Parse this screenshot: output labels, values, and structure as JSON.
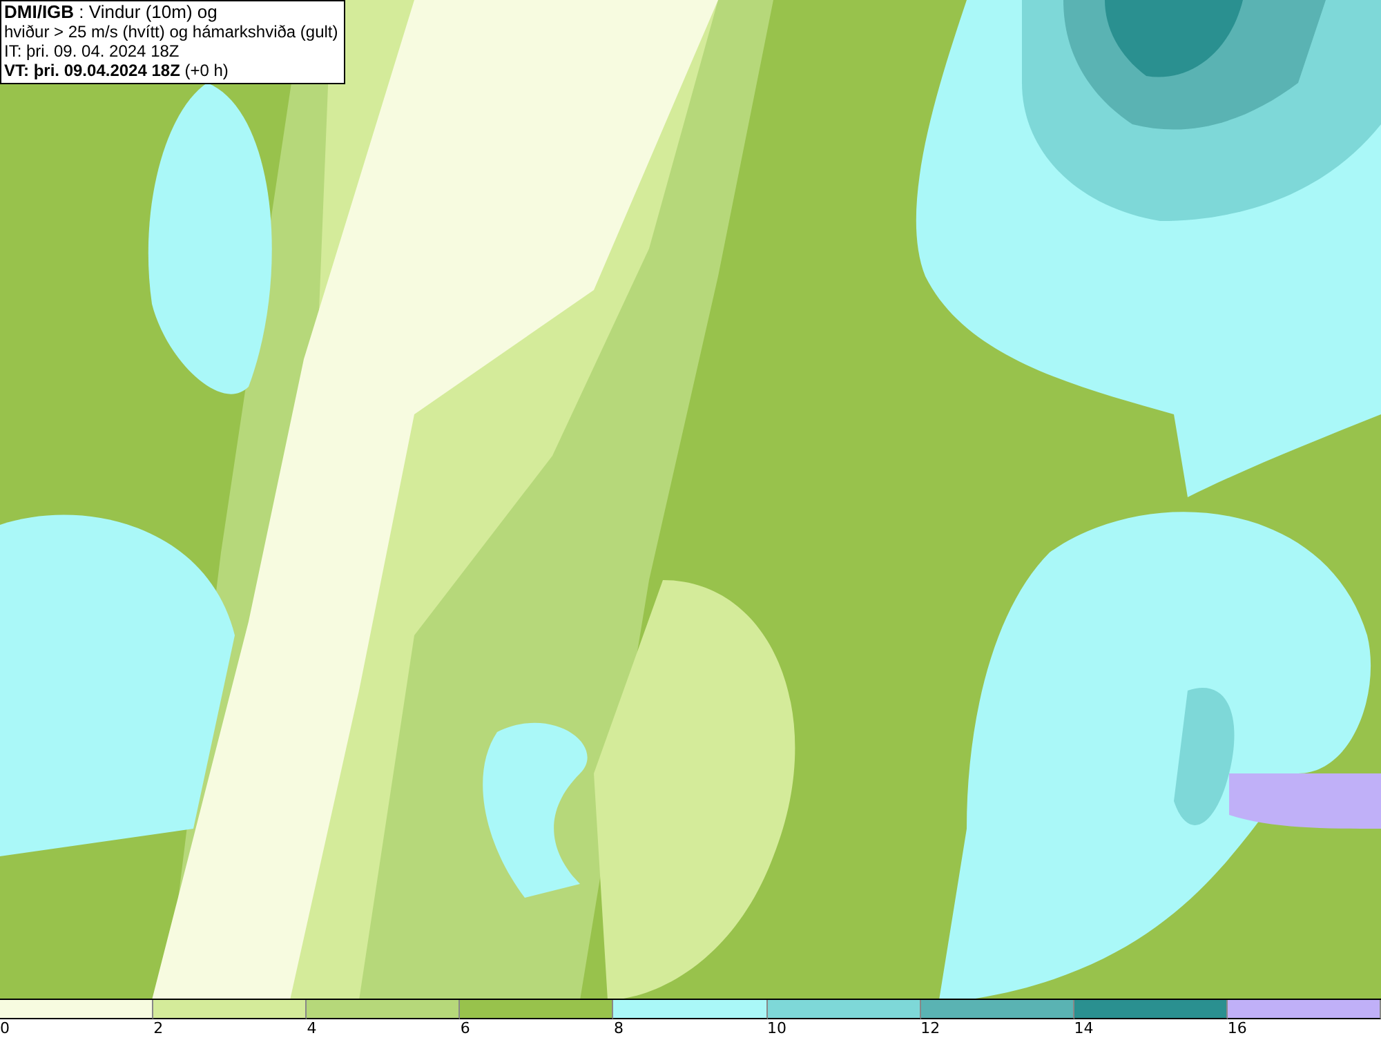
{
  "title_box": {
    "lines": [
      "**DMI/IGB** : Vindur (10m) og",
      "hviður > 25 m/s (hvítt) og hámarkshviða (gult)",
      "IT: þri. 09. 04. 2024 18Z",
      "**VT: þri. 09.04.2024 18Z** (+0 h)"
    ]
  },
  "legend": {
    "bins": [
      {
        "label": "0",
        "color": "#f7fbe0"
      },
      {
        "label": "2",
        "color": "#d4eb9a"
      },
      {
        "label": "4",
        "color": "#b6d87a"
      },
      {
        "label": "6",
        "color": "#98c24c"
      },
      {
        "label": "8",
        "color": "#aaf8f8"
      },
      {
        "label": "10",
        "color": "#7ed8d8"
      },
      {
        "label": "12",
        "color": "#5ab3b3"
      },
      {
        "label": "14",
        "color": "#2a9090"
      },
      {
        "label": "16",
        "color": "#c0b0f8"
      }
    ]
  }
}
